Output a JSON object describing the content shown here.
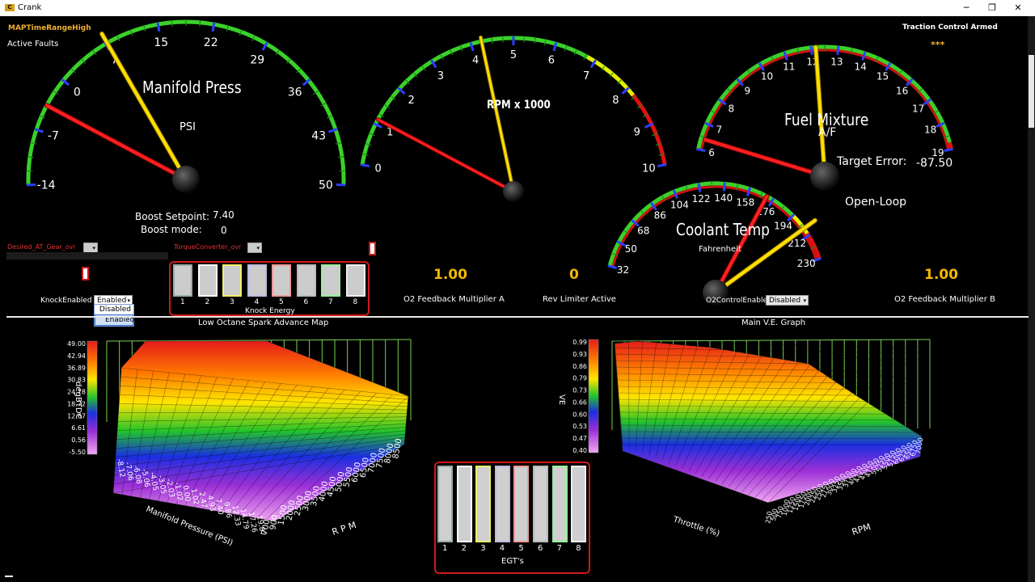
{
  "window": {
    "title": "Crank",
    "app_icon": "crank-app-icon",
    "min": "─",
    "restore": "❐",
    "close": "✕"
  },
  "status": {
    "map_time_range": "MAPTimeRangeHigh",
    "active_faults": "Active Faults",
    "traction_control": "Traction Control Armed",
    "stars": "***"
  },
  "gauges": {
    "manifold": {
      "title": "Manifold Press",
      "unit": "PSI",
      "ticks": [
        "-14",
        "-7",
        "0",
        "7",
        "15",
        "22",
        "29",
        "36",
        "43",
        "50"
      ]
    },
    "rpm": {
      "title": "RPM x 1000",
      "ticks": [
        "0",
        "1",
        "2",
        "3",
        "4",
        "5",
        "6",
        "7",
        "8",
        "9",
        "10"
      ]
    },
    "fuel": {
      "title": "Fuel Mixture",
      "unit": "A/F",
      "ticks": [
        "6",
        "7",
        "8",
        "9",
        "10",
        "11",
        "12",
        "13",
        "14",
        "15",
        "16",
        "17",
        "18",
        "19"
      ]
    },
    "coolant": {
      "title": "Coolant Temp",
      "unit": "Fahrenheit",
      "ticks": [
        "32",
        "50",
        "68",
        "86",
        "104",
        "122",
        "140",
        "158",
        "176",
        "194",
        "212",
        "230"
      ]
    }
  },
  "boost": {
    "setpoint_label": "Boost Setpoint:",
    "setpoint_value": "7.40",
    "mode_label": "Boost mode:",
    "mode_value": "0"
  },
  "fuel_info": {
    "target_label": "Target Error:",
    "target_value": "-87.50",
    "loop_mode": "Open-Loop"
  },
  "controls": {
    "desired_gear": "Desired_AT_Gear_ovr",
    "torque_conv": "TorqueConverter_ovr",
    "knock_label": "KnockEnabled",
    "knock_value": "Enabled",
    "knock_options": [
      "Disabled",
      "Enabled"
    ],
    "o2_label": "O2ControlEnable",
    "o2_value": "Disabled"
  },
  "knock_energy": {
    "label": "Knock Energy",
    "channels": [
      "1",
      "2",
      "3",
      "4",
      "5",
      "6",
      "7",
      "8"
    ]
  },
  "egt": {
    "label": "EGT's",
    "channels": [
      "1",
      "2",
      "3",
      "4",
      "5",
      "6",
      "7",
      "8"
    ]
  },
  "readouts": {
    "o2a_value": "1.00",
    "o2a_label": "O2 Feedback Multiplier A",
    "rev_value": "0",
    "rev_label": "Rev Limiter Active",
    "o2b_value": "1.00",
    "o2b_label": "O2 Feedback Multiplier B"
  },
  "spark_map": {
    "title": "Low Octane Spark Advance Map",
    "z_label": "degBTDC",
    "z_ticks": [
      "49.00",
      "42.94",
      "36.89",
      "30.83",
      "24.78",
      "18.72",
      "12.67",
      "6.61",
      "0.56",
      "-5.50"
    ],
    "x_label": "Manifold Pressure (PSI)",
    "x_ticks": [
      "-8.12",
      "-7.06",
      "-6.08",
      "-5.06",
      "-4.05",
      "-3.05",
      "-2.03",
      "-1.02",
      "0.00",
      "1.02",
      "2.47",
      "4.93",
      "7.40",
      "9.86",
      "12.33",
      "14.79",
      "17.26",
      "19.87"
    ],
    "y_label": "R P M",
    "y_ticks": [
      "700",
      "900",
      "1500",
      "2000",
      "2500",
      "3000",
      "3500",
      "4000",
      "4500",
      "5000",
      "5500",
      "6000",
      "6500",
      "7000",
      "7500",
      "8000",
      "8500"
    ]
  },
  "ve_graph": {
    "title": "Main V.E. Graph",
    "z_label": "VE",
    "z_ticks": [
      "0.99",
      "0.93",
      "0.86",
      "0.79",
      "0.73",
      "0.66",
      "0.60",
      "0.53",
      "0.47",
      "0.40"
    ],
    "x_label": "Throttle (%)",
    "y_label": "RPM",
    "y_ticks": [
      "250",
      "500",
      "750",
      "1000",
      "1250",
      "1500",
      "1750",
      "2000",
      "2250",
      "2500",
      "2750",
      "3000",
      "3250",
      "3500",
      "3750",
      "4000",
      "4250",
      "4500",
      "4750",
      "5000",
      "5250",
      "5500",
      "5750",
      "6000",
      "6250",
      "6500",
      "6750",
      "7000"
    ]
  }
}
